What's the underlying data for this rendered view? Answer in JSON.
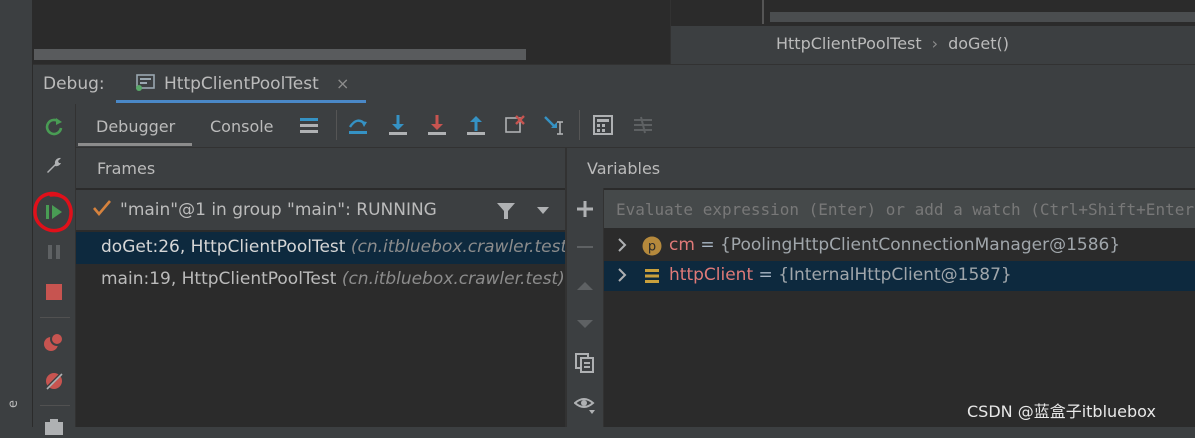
{
  "left_strip": {
    "label": "e"
  },
  "editor": {
    "breadcrumb": [
      "HttpClientPoolTest",
      "doGet()"
    ]
  },
  "debug_window": {
    "label": "Debug:",
    "tab": {
      "label": "HttpClientPoolTest",
      "close_symbol": "×"
    }
  },
  "left_toolbar": {
    "icons": [
      "rerun-icon",
      "settings-wrench-icon",
      "resume-program-icon",
      "pause-program-icon",
      "stop-icon",
      "view-breakpoints-icon",
      "mute-breakpoints-icon",
      "camera-icon"
    ]
  },
  "debugger_toolbar": {
    "tabs": [
      "Debugger",
      "Console"
    ],
    "active_tab": "Debugger",
    "icons": [
      "show-execution-point-icon",
      "step-over-icon",
      "step-into-icon",
      "force-step-into-icon",
      "step-out-icon",
      "drop-frame-icon",
      "run-to-cursor-icon",
      "evaluate-expression-icon",
      "trace-current-stream-icon"
    ]
  },
  "frames": {
    "title": "Frames",
    "thread": "\"main\"@1 in group \"main\": RUNNING",
    "items": [
      {
        "method": "doGet:26, HttpClientPoolTest",
        "package": "(cn.itbluebox.crawler.test)",
        "selected": true
      },
      {
        "method": "main:19, HttpClientPoolTest",
        "package": "(cn.itbluebox.crawler.test)",
        "selected": false
      }
    ]
  },
  "variables": {
    "title": "Variables",
    "evaluate_placeholder": "Evaluate expression (Enter) or add a watch (Ctrl+Shift+Enter)",
    "items": [
      {
        "icon": "protected-field-icon",
        "icon_letter": "p",
        "name": "cm",
        "eq": " = ",
        "value": "{PoolingHttpClientConnectionManager@1586}"
      },
      {
        "icon": "field-icon",
        "name": "httpClient",
        "eq": " = ",
        "value": "{InternalHttpClient@1587}",
        "selected": true
      }
    ]
  },
  "watermark": "CSDN @蓝盒子itbluebox",
  "colors": {
    "panel_bg": "#3c3f41",
    "editor_bg": "#2b2b2b",
    "selection": "#0d293e",
    "accent_blue": "#3592c4",
    "resume_green": "#499c54",
    "stop_red": "#c75450",
    "annotation_red": "#e0101a",
    "variable_name": "#e07a78"
  }
}
